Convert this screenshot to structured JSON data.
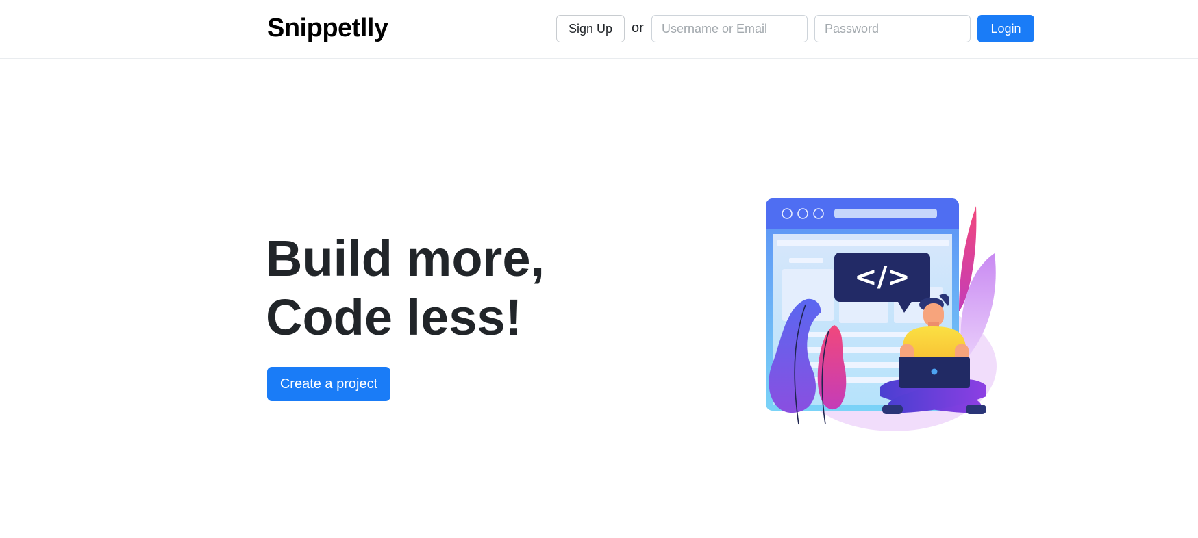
{
  "header": {
    "brand": "Snippetlly",
    "signup_label": "Sign Up",
    "or_text": "or",
    "username_placeholder": "Username or Email",
    "password_placeholder": "Password",
    "login_label": "Login"
  },
  "hero": {
    "title_line1": "Build more,",
    "title_line2": "Code less!",
    "cta_label": "Create a project",
    "illustration_code_glyph": "</>"
  },
  "colors": {
    "primary": "#1a7cf7",
    "heading": "#212529"
  },
  "icons": {
    "illustration": "developer-with-laptop-illustration"
  }
}
